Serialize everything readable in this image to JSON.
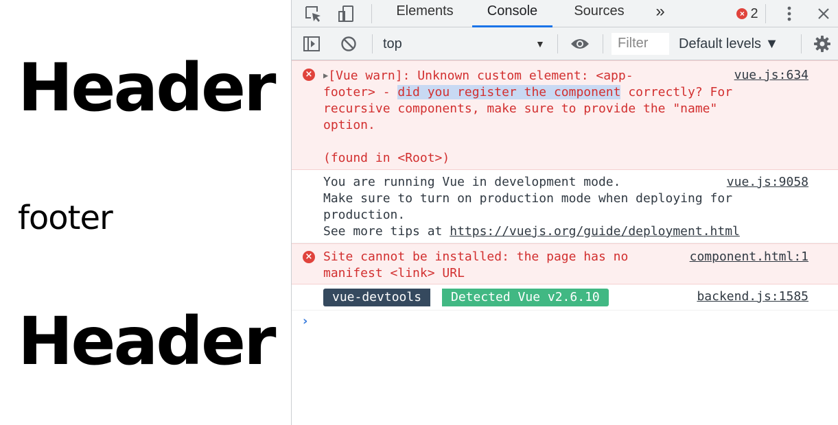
{
  "page": {
    "header_top": "Header",
    "footer": "footer",
    "header_bottom": "Header"
  },
  "devtools": {
    "tabs": {
      "elements": "Elements",
      "console": "Console",
      "sources": "Sources",
      "more": "»",
      "error_count": "2"
    },
    "toolbar": {
      "context": "top",
      "filter_placeholder": "Filter",
      "levels": "Default levels ▼"
    },
    "messages": [
      {
        "level": "error",
        "line1_pre": "[Vue warn]: Unknown custom element: <app-",
        "line2_pre": "footer> - ",
        "line2_highlight": "did you register the component",
        "line2_post": " correctly? For",
        "line3": "recursive components, make sure to provide the \"name\"",
        "line4": "option.",
        "line5": "",
        "line6": "(found in <Root>)",
        "source": "vue.js:634"
      },
      {
        "level": "info",
        "line1": "You are running Vue in development mode.",
        "line2": "Make sure to turn on production mode when deploying for",
        "line3": "production.",
        "line4_pre": "See more tips at ",
        "line4_link": "https://vuejs.org/guide/deployment.html",
        "source": "vue.js:9058"
      },
      {
        "level": "error",
        "line1": "Site cannot be installed: the page has no",
        "line2": "manifest <link> URL",
        "source": "component.html:1"
      },
      {
        "level": "info",
        "badge_left": "vue-devtools",
        "badge_right": "Detected Vue v2.6.10",
        "source": "backend.js:1585"
      }
    ],
    "prompt": "›"
  },
  "colors": {
    "error_bg": "#fdefef",
    "error_text": "#d22f2f",
    "active_tab": "#1a73e8",
    "vue_dark": "#35495e",
    "vue_green": "#41b883"
  }
}
